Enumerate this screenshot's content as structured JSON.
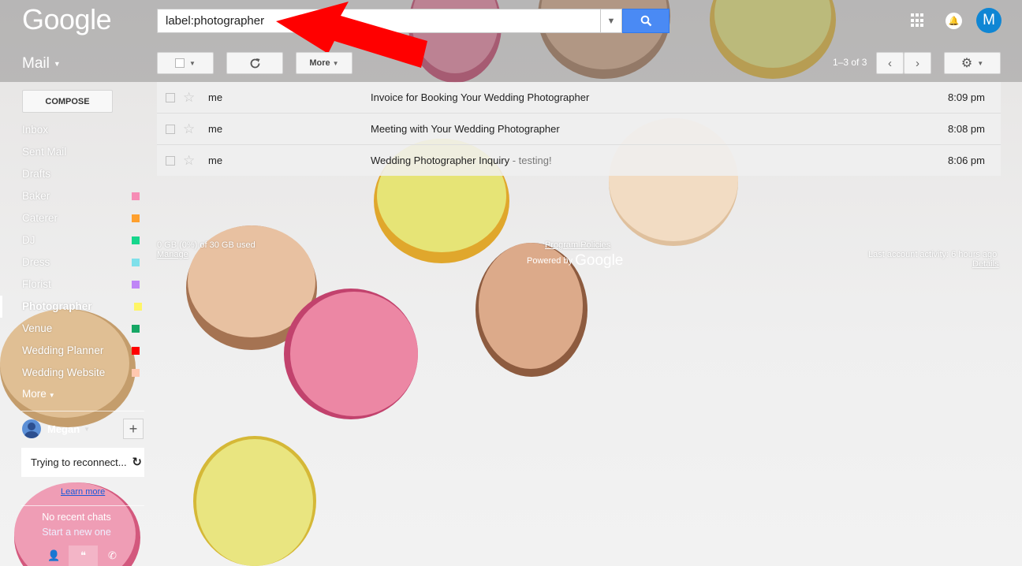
{
  "header": {
    "logo": "Google",
    "search_value": "label:photographer",
    "avatar_letter": "M"
  },
  "toolbar": {
    "mail_label": "Mail",
    "more_label": "More",
    "pager": "1–3 of 3"
  },
  "sidebar": {
    "compose": "COMPOSE",
    "items": [
      {
        "label": "Inbox",
        "color": ""
      },
      {
        "label": "Sent Mail",
        "color": ""
      },
      {
        "label": "Drafts",
        "color": ""
      },
      {
        "label": "Baker",
        "color": "#f68db5"
      },
      {
        "label": "Caterer",
        "color": "#ffa02e"
      },
      {
        "label": "DJ",
        "color": "#16d68c"
      },
      {
        "label": "Dress",
        "color": "#7fe0ea"
      },
      {
        "label": "Florist",
        "color": "#bf85f6"
      },
      {
        "label": "Photographer",
        "color": "#fff566",
        "active": true
      },
      {
        "label": "Venue",
        "color": "#16a765"
      },
      {
        "label": "Wedding Planner",
        "color": "#ff0000"
      },
      {
        "label": "Wedding Website",
        "color": "#ffc8af"
      }
    ],
    "more": "More",
    "hangout_user": "Megan",
    "reconnect": "Trying to reconnect...",
    "learn_more": "Learn more",
    "no_chats": "No recent chats",
    "start_new": "Start a new one"
  },
  "messages": [
    {
      "from": "me",
      "subject": "Invoice for Booking Your Wedding Photographer",
      "snippet": "",
      "time": "8:09 pm"
    },
    {
      "from": "me",
      "subject": "Meeting with Your Wedding Photographer",
      "snippet": "",
      "time": "8:08 pm"
    },
    {
      "from": "me",
      "subject": "Wedding Photographer Inquiry",
      "snippet": " - testing!",
      "time": "8:06 pm"
    }
  ],
  "footer": {
    "storage": "0 GB (0%) of 30 GB used",
    "manage": "Manage",
    "program_policies": "Program Policies",
    "powered_by": "Powered by",
    "powered_google": "Google",
    "last_activity": "Last account activity: 6 hours ago",
    "details": "Details"
  },
  "colors": {
    "search_button": "#4a8af4",
    "avatar": "#0f86d4",
    "annotation_arrow": "#ff0000"
  }
}
